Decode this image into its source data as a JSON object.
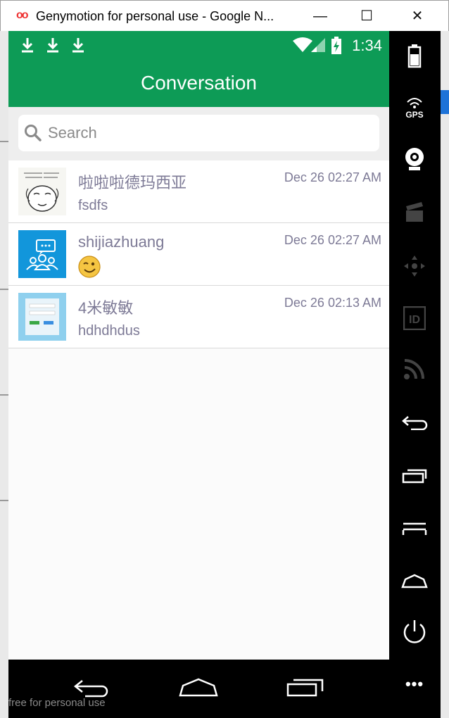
{
  "window": {
    "logo": "oo",
    "title": "Genymotion for personal use - Google N...",
    "minimize": "—",
    "maximize": "☐",
    "close": "✕"
  },
  "statusbar": {
    "time": "1:34"
  },
  "appbar": {
    "title": "Conversation"
  },
  "search": {
    "placeholder": "Search"
  },
  "conversations": [
    {
      "name": "啦啦啦德玛西亚",
      "time": "Dec 26 02:27 AM",
      "message": "fsdfs",
      "avatar": "sketch-avatar"
    },
    {
      "name": "shijiazhuang",
      "time": "Dec 26 02:27 AM",
      "message": "",
      "emoji": "wink-emoji",
      "avatar": "group-chat-avatar"
    },
    {
      "name": "4米敏敏",
      "time": "Dec 26 02:13 AM",
      "message": "hdhdhdus",
      "avatar": "screenshot-avatar"
    }
  ],
  "sidebar": {
    "icons": [
      "battery-icon",
      "gps-icon",
      "webcam-icon",
      "clapperboard-icon",
      "dpad-icon",
      "id-icon",
      "rss-icon",
      "back-icon",
      "recent-apps-icon",
      "menu-icon",
      "home-icon",
      "power-icon",
      "more-icon"
    ],
    "gps_label": "GPS",
    "id_label": "ID",
    "more_label": "•••"
  },
  "navbar": {
    "icons": [
      "nav-back-icon",
      "nav-home-icon",
      "nav-recent-icon"
    ]
  },
  "watermark": "free for personal use",
  "colors": {
    "accent": "#0d9b56",
    "text_muted": "#7d7a96",
    "search_bg": "#eeeeee"
  }
}
